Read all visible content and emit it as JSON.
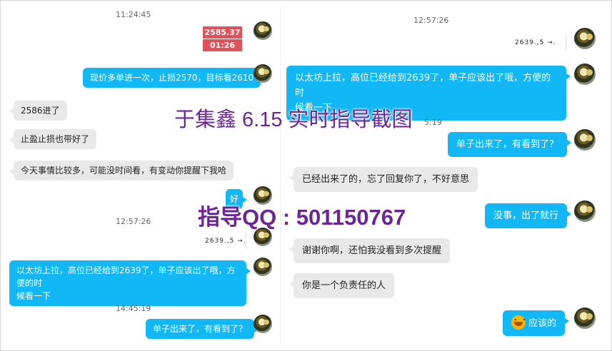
{
  "left": {
    "time1": "11:24:45",
    "stock_price": "2585.37",
    "stock_time": "01:26",
    "msg_out_1": "现价多单进一次，止损2570，目标看2610",
    "msg_in_1": "2586进了",
    "msg_in_2": "止盈止损也带好了",
    "msg_in_3": "今天事情比较多，可能没时间看，有变动你提醒下我哈",
    "msg_out_2": "好",
    "time2": "12:57:26",
    "card_text": "2639.,5 →.",
    "msg_out_3_line1": "以太坊上拉，高位已经给到2639了，单子应该出了哦，方便的时",
    "msg_out_3_line2": "候看一下",
    "time3": "14:45:19",
    "msg_out_4": "单子出来了，有看到了？"
  },
  "right": {
    "time1": "12:57:26",
    "card_text": "2639.,5 →.",
    "msg_out_1_line1": "以太坊上拉，高位已经给到2639了，单子应该出了哦，方便的时",
    "msg_out_1_line2": "候看一下",
    "time2_partial": "5:19",
    "msg_out_2": "单子出来了，有看到了？",
    "msg_in_1": "已经出来了的，忘了回复你了，不好意思",
    "msg_out_3": "没事，出了就行",
    "msg_in_2": "谢谢你啊，还怕我没看到多次提醒",
    "msg_in_3": "你是一个负责任的人",
    "msg_out_4": "应该的",
    "emoji_icon": "grin-emoji-icon"
  },
  "overlay": {
    "title": "于集鑫 6.15 实时指导截图",
    "qq": "指导QQ : 501150767"
  },
  "colors": {
    "outgoing_bubble": "#12b7f5",
    "incoming_bubble": "#e9e9e9",
    "stock_red": "#e0525a",
    "watermark": "#6b2594"
  }
}
